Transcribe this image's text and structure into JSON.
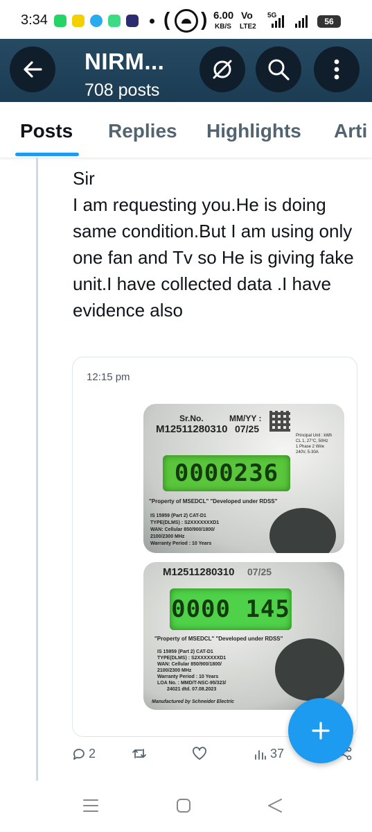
{
  "status_bar": {
    "time": "3:34",
    "net_speed_value": "6.00",
    "net_speed_unit": "KB/S",
    "vo_label": "Vo",
    "lte_label": "LTE2",
    "fiveg_label": "5G",
    "battery": "56",
    "app_icon_colors": [
      "#25d366",
      "#fffc00",
      "#2aabee",
      "#3ddc84",
      "#2b2d6e"
    ]
  },
  "header": {
    "title": "NIRM...",
    "posts_count": "708 posts",
    "background": "#1b3c53"
  },
  "tabs": [
    {
      "label": "Posts",
      "active": true
    },
    {
      "label": "Replies",
      "active": false
    },
    {
      "label": "Highlights",
      "active": false
    },
    {
      "label": "Arti",
      "active": false
    }
  ],
  "post": {
    "text": "Sir\nI am requesting you.He is doing same condition.But I am using only one fan and Tv so He is giving fake unit.I have collected data .I have evidence also",
    "media": {
      "timestamp": "12:15 pm",
      "photo_top": {
        "sr_label": "Sr.No.",
        "mmyy_label": "MM/YY :",
        "serial": "M12511280310",
        "date": "07/25",
        "reading": "0000236",
        "property_line": "\"Property of MSEDCL\"   \"Developed under RDSS\"",
        "is_line": "IS 15959 (Part 2) CAT-D1",
        "type_line": "TYPE(DLMS) : S2XXXXXXXD1",
        "wan_line": "WAN: Cellular 850/900/1800/",
        "mhz_line": "2100/2300 MHz",
        "warranty_line": "Warranty Period : 10 Years",
        "side_info": "Principal Unit : kWh\nCL 1, 27°C, 50Hz\n1 Phase 2 Wire\n240V, 5-30A"
      },
      "photo_bottom": {
        "serial": "M12511280310",
        "date": "07/25",
        "reading": "0000 145",
        "property_line": "\"Property of MSEDCL\"   \"Developed under RDSS\"",
        "is_line": "IS 15959 (Part 2) CAT-D1",
        "type_line": "TYPE(DLMS) : S2XXXXXXXD1",
        "wan_line": "WAN: Cellular 850/900/1800/",
        "mhz_line": "2100/2300 MHz",
        "warranty_line": "Warranty Period : 10 Years",
        "loa_line": "LOA No. : MMD/T-NSC-95/323/",
        "loa_date": "24021 dtd. 07.08.2023",
        "manufacturer": "Manufactured by Schneider Electric"
      }
    },
    "actions": {
      "replies": "2",
      "reposts": "",
      "likes": "",
      "views": "37"
    }
  },
  "colors": {
    "accent": "#1d9bf0",
    "text_primary": "#0f1419",
    "text_secondary": "#536471"
  }
}
